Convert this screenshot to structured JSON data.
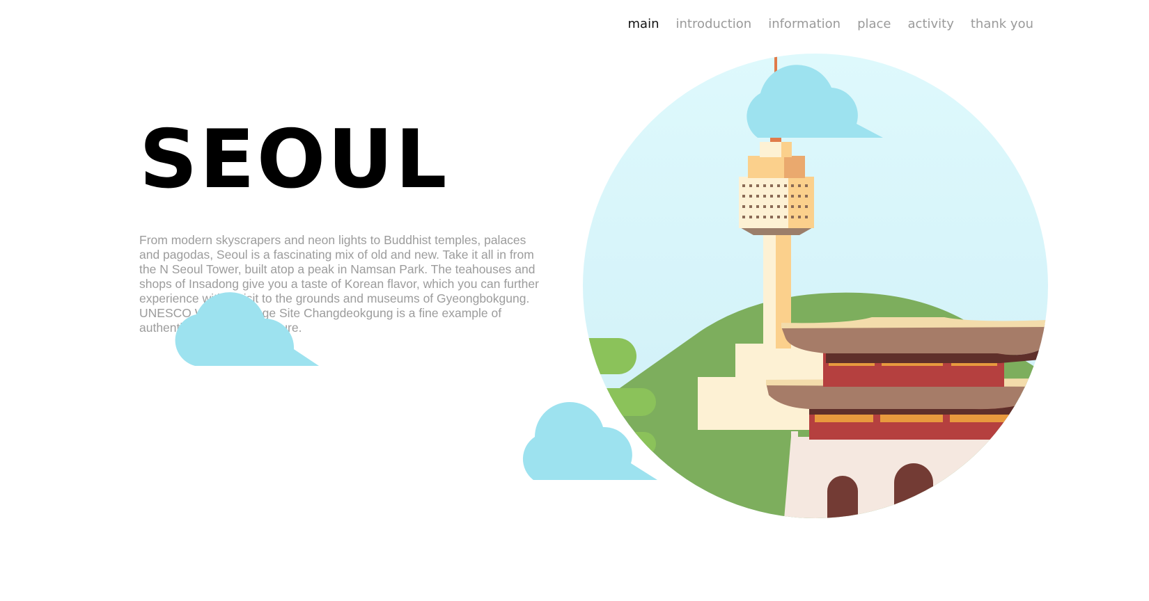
{
  "nav": {
    "items": [
      {
        "label": "main",
        "active": true
      },
      {
        "label": "introduction",
        "active": false
      },
      {
        "label": "information",
        "active": false
      },
      {
        "label": "place",
        "active": false
      },
      {
        "label": "activity",
        "active": false
      },
      {
        "label": "thank you",
        "active": false
      }
    ]
  },
  "hero": {
    "title": "SEOUL",
    "description": "From modern skyscrapers and neon lights to Buddhist temples, palaces and pagodas, Seoul is a fascinating mix of old and new. Take it all in from the N Seoul Tower, built atop a peak in Namsan Park. The teahouses and shops of Insadong give you a taste of Korean flavor, which you can further experience with a visit to the grounds and museums of Gyeongbokgung. UNESCO World Heritage Site Changdeokgung is a fine example of authentic ancient architecture."
  },
  "illustration": {
    "icons": [
      "cloud-icon",
      "n-seoul-tower-icon",
      "palace-gate-icon",
      "hill-icon"
    ],
    "colors": {
      "sky": "#d8f7fb",
      "cloud": "#9de2ef",
      "hill": "#7dae5d",
      "tower": "#fbd08c",
      "roof": "#a67c68",
      "palace": "#b5403f",
      "wall": "#f5e8e0"
    }
  }
}
